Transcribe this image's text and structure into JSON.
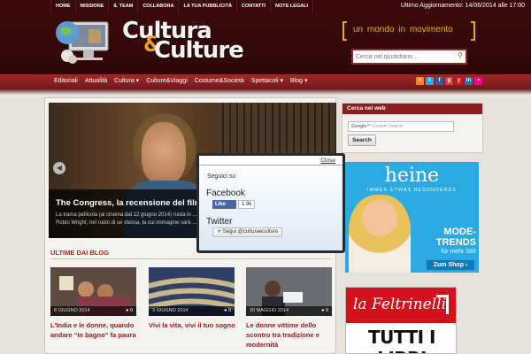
{
  "topbar": {
    "nav": [
      "HOME",
      "MISSIONE",
      "IL TEAM",
      "COLLABORA",
      "LA TUA PUBBLICITÀ",
      "CONTATTI",
      "NOTE LEGALI"
    ],
    "updated": "Ultimo Aggiornamento: 14/06/2014 alle 17:00"
  },
  "header": {
    "logo_line1": "Cultura",
    "logo_amp": "&",
    "logo_line2": "Culture",
    "tagline": "un mondo in movimento",
    "search_placeholder": "Cerca nel quotidiano ..."
  },
  "mainnav": {
    "items": [
      "Editoriali",
      "Attualità",
      "Cultura ▾",
      "Culture&Viaggi",
      "Costume&Società",
      "Spettacoli ▾",
      "Blog ▾"
    ]
  },
  "social_icons": [
    {
      "name": "rss-icon",
      "color": "#f08a24",
      "glyph": "r"
    },
    {
      "name": "twitter-icon",
      "color": "#29a9e1",
      "glyph": "t"
    },
    {
      "name": "facebook-icon",
      "color": "#3b5998",
      "glyph": "f"
    },
    {
      "name": "googleplus-icon",
      "color": "#d73d32",
      "glyph": "g"
    },
    {
      "name": "youtube-icon",
      "color": "#cc181e",
      "glyph": "y"
    },
    {
      "name": "linkedin-icon",
      "color": "#0e76a8",
      "glyph": "in"
    },
    {
      "name": "flickr-icon",
      "color": "#ff0084",
      "glyph": "•"
    }
  ],
  "slider": {
    "title": "The Congress, la recensione del film",
    "text": "La trama pellicola (al cinema dal 12 giugno 2014) ruota in ... Robin Wright, nel ruolo di se stessa, la cui immagine sarà ..."
  },
  "popup": {
    "close": "Close",
    "follow": "Seguici su",
    "facebook": "Facebook",
    "like": "Like",
    "like_count": "1.9k",
    "twitter": "Twitter",
    "twitter_follow": "Segui @culturaeculture"
  },
  "blog": {
    "title": "ULTIME DAI BLOG",
    "cards": [
      {
        "date": "8 GIUGNO 2014",
        "comments": "0",
        "title": "L'India e le donne, quando andare “in bagno” fa paura",
        "bg": "#5e4a3e"
      },
      {
        "date": "3 GIUGNO 2014",
        "comments": "0",
        "title": "Vivi la vita, vivi il tuo sogno",
        "bg": "#2f3f66"
      },
      {
        "date": "20 MAGGIO 2014",
        "comments": "0",
        "title": "Le donne vittime dello scontro tra tradizione e modernità",
        "bg": "#6a6e74"
      }
    ]
  },
  "sidebar": {
    "search_title": "Cerca nel web",
    "google_label": "Google™",
    "custom_search": "Custom Search",
    "search_button": "Search"
  },
  "ads": {
    "heine_brand": "heine",
    "heine_sub": "IMMER ETWAS BESONDERES",
    "heine_mode": "MODE-TRENDS",
    "heine_mehr": "für mehr Stil!",
    "heine_shop": "Zum Shop ›",
    "feltrinelli_logo": "la Feltrinelli",
    "feltrinelli_text": "TUTTI I LIBRI"
  }
}
